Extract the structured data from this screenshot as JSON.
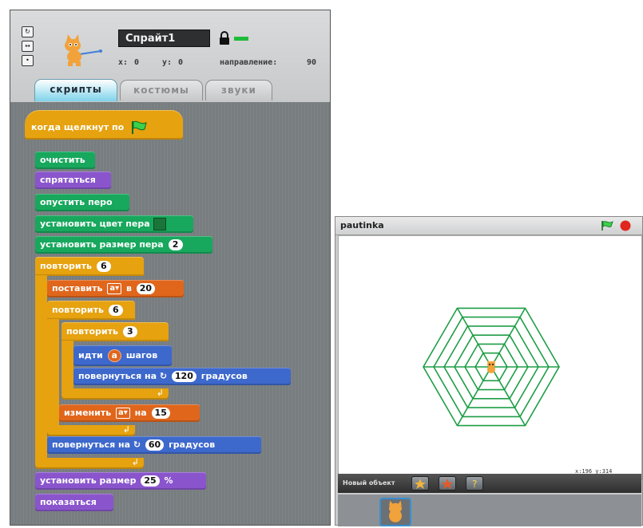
{
  "sprite": {
    "name": "Спрайт1",
    "x_label": "x:",
    "x_value": "0",
    "y_label": "y:",
    "y_value": "0",
    "direction_label": "направление:",
    "direction_value": "90",
    "rotation_style_buttons": [
      "rotate",
      "left-right",
      "no-rotate"
    ]
  },
  "tabs": [
    {
      "label": "скрипты",
      "active": true
    },
    {
      "label": "костюмы",
      "active": false
    },
    {
      "label": "звуки",
      "active": false
    }
  ],
  "script": {
    "hat": "когда щелкнут по",
    "clear": "очистить",
    "hide": "спрятаться",
    "pen_down": "опустить перо",
    "set_pen_color": "установить цвет пера",
    "pen_color": "#19753a",
    "set_pen_size": "установить размер пера",
    "pen_size": "2",
    "repeat_outer": "повторить",
    "repeat_outer_count": "6",
    "set_var": "поставить",
    "set_var_name": "a",
    "set_var_to": "в",
    "set_var_value": "20",
    "repeat_mid": "повторить",
    "repeat_mid_count": "6",
    "repeat_inner": "повторить",
    "repeat_inner_count": "3",
    "move": "идти",
    "move_var": "a",
    "move_suffix": "шагов",
    "turn1": "повернуться на",
    "turn1_value": "120",
    "turn1_suffix": "градусов",
    "change_var": "изменить",
    "change_var_name": "a",
    "change_var_by": "на",
    "change_var_value": "15",
    "turn2": "повернуться на",
    "turn2_value": "60",
    "turn2_suffix": "градусов",
    "set_size": "установить размер",
    "set_size_value": "25",
    "set_size_suffix": "%",
    "show": "показаться"
  },
  "stage": {
    "title": "pautinka",
    "mouse_coords": "x:196  y:314",
    "new_object_label": "Новый объект",
    "web_color": "#1e9e45"
  },
  "colors": {
    "control": "#e6a20f",
    "pen": "#17a85d",
    "looks": "#8a55cc",
    "variables": "#e0661c",
    "motion": "#3d68cc"
  }
}
